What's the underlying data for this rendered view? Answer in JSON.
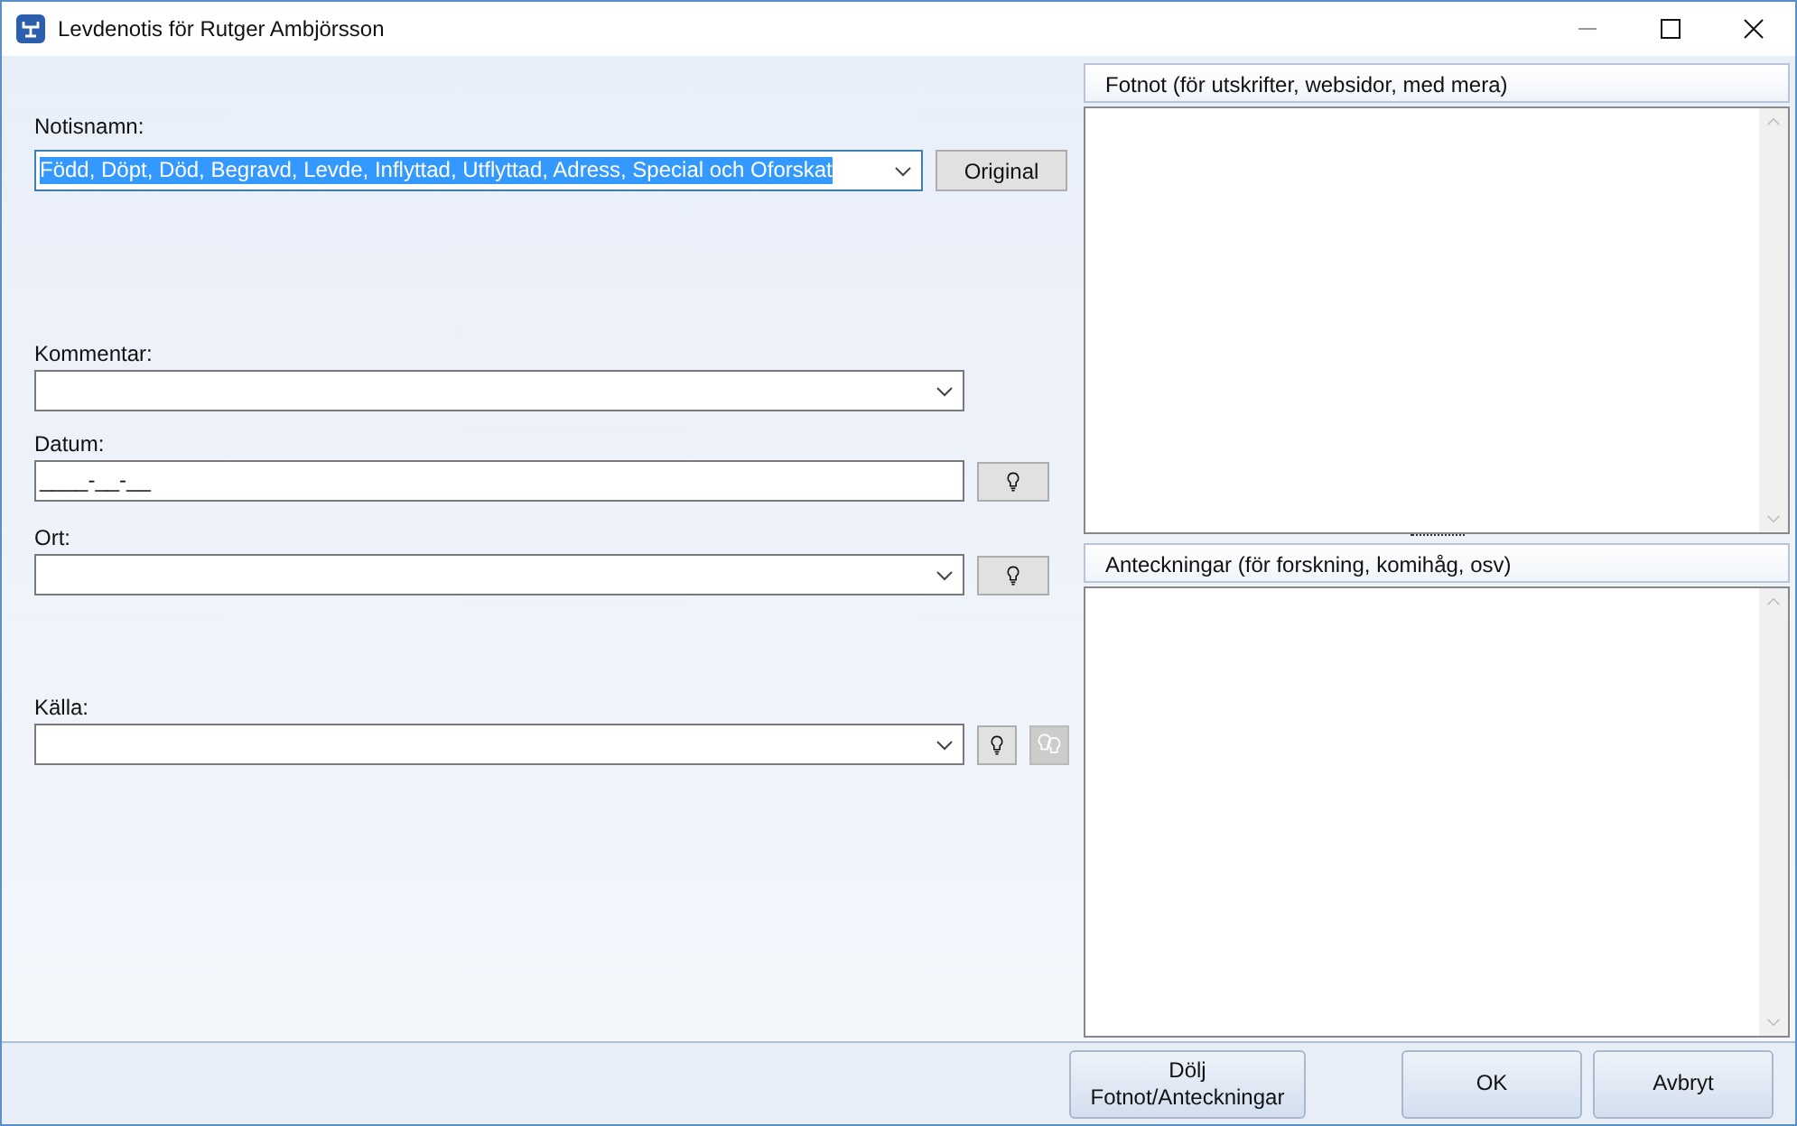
{
  "window": {
    "title": "Levdenotis för Rutger Ambjörsson"
  },
  "fields": [
    {
      "label": "Notisnamn:",
      "kind": "combo",
      "value": "Född, Döpt, Död, Begravd, Levde, Inflyttad, Utflyttad, Adress, Special och Oforskat",
      "selected": true,
      "buttons": [
        {
          "kind": "text",
          "label": "Original",
          "disabled": false
        }
      ]
    },
    {
      "label": "Kommentar:",
      "kind": "combo",
      "selected": false
    },
    {
      "label": "Datum:",
      "kind": "text",
      "value": "____-__-__",
      "selected": false,
      "buttons": [
        {
          "kind": "bulb",
          "disabled": false
        }
      ]
    },
    {
      "label": "Ort:",
      "kind": "combo",
      "selected": false,
      "buttons": [
        {
          "kind": "bulb",
          "disabled": false
        }
      ]
    },
    {
      "label": "Källa:",
      "kind": "combo",
      "selected": false,
      "buttons": [
        {
          "kind": "bulb",
          "disabled": false
        },
        {
          "kind": "bulbs",
          "disabled": true
        }
      ]
    }
  ],
  "panels": [
    {
      "title": "Fotnot (för utskrifter, websidor, med mera)"
    },
    {
      "title": "Anteckningar (för forskning, komihåg, osv)"
    }
  ],
  "footer_buttons": [
    "Dölj\nFotnot/Anteckningar",
    "OK",
    "Avbryt"
  ]
}
